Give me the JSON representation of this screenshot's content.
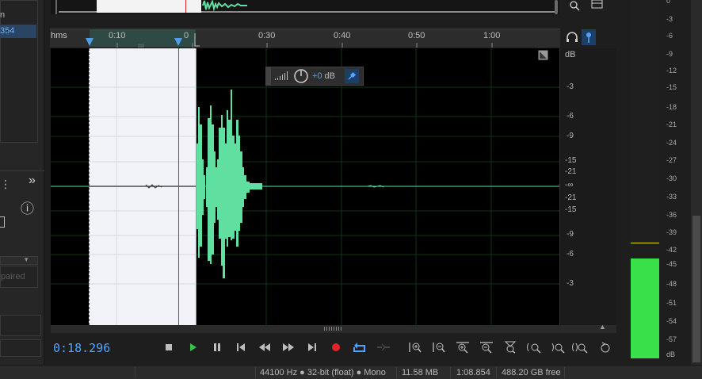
{
  "left_panel": {
    "top_fragment": "n",
    "selected_fragment": "354",
    "expand_glyph": "»",
    "info_glyph": "ⓘ",
    "disabled_fragment": "paired"
  },
  "ruler": {
    "format_label": "hms",
    "ticks": [
      "0:10",
      "0:30",
      "0:40",
      "0:50",
      "1:00"
    ],
    "partial_tick": "0"
  },
  "hud": {
    "volume_value": "+0",
    "unit": "dB"
  },
  "db_scale": {
    "header": "dB",
    "labels": [
      "-3",
      "-6",
      "-9",
      "-15",
      "-21",
      "-∞",
      "-21",
      "-15",
      "-9",
      "-6",
      "-3"
    ]
  },
  "meter": {
    "labels": [
      "0",
      "-3",
      "-6",
      "-9",
      "-12",
      "-15",
      "-18",
      "-21",
      "-24",
      "-27",
      "-30",
      "-33",
      "-36",
      "-39",
      "-42",
      "-45",
      "-48",
      "-51",
      "-54",
      "-57",
      "dB"
    ],
    "level_color": "#39e04a",
    "peak_color": "#e6e600"
  },
  "transport": {
    "current_time": "0:18.296"
  },
  "status_bar": {
    "format": "44100 Hz ● 32-bit (float) ● Mono",
    "file_size": "11.58 MB",
    "duration": "1:08.854",
    "free_space": "488.20 GB free"
  },
  "colors": {
    "waveform": "#5fe0a0",
    "playhead": "#e0242a",
    "accent": "#4fa3ff",
    "selection": "#f1f3f9"
  }
}
